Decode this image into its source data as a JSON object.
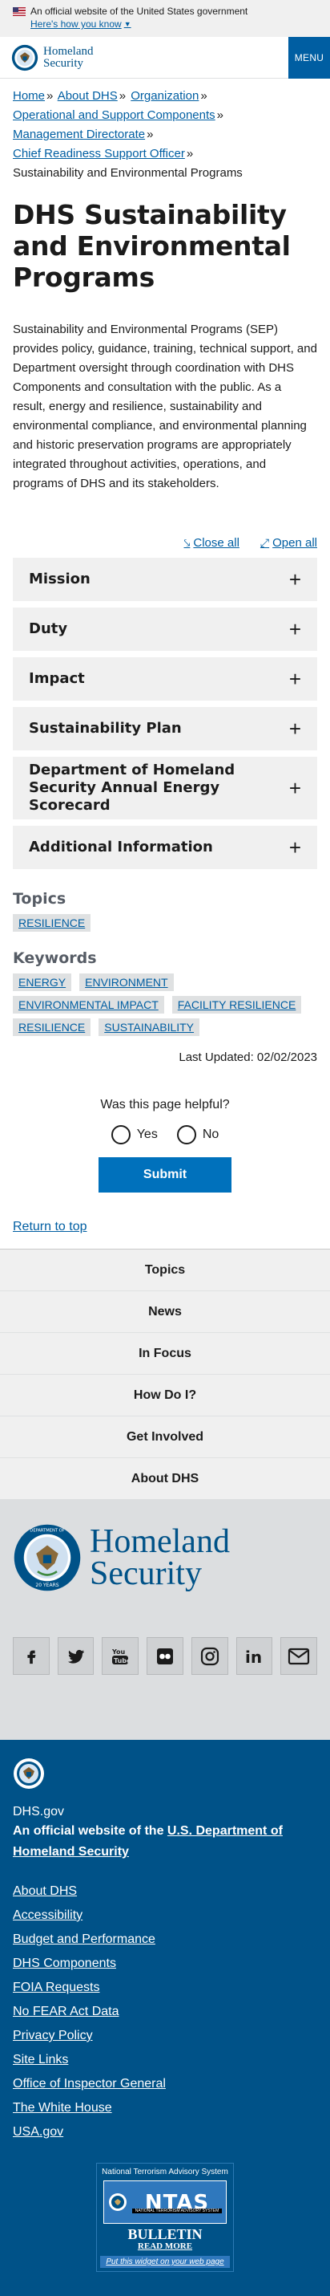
{
  "gov_banner": {
    "official_text": "An official website of the United States government",
    "how_you_know": "Here's how you know",
    "flag_icon": "us-flag-icon"
  },
  "header": {
    "logo_line1": "Homeland",
    "logo_line2": "Security",
    "menu_label": "MENU"
  },
  "breadcrumb": {
    "items": [
      "Home",
      "About DHS",
      "Organization",
      "Operational and Support Components",
      "Management Directorate",
      "Chief Readiness Support Officer"
    ],
    "current": "Sustainability and Environmental Programs",
    "separator": "»"
  },
  "page": {
    "title": "DHS Sustainability and Environmental Programs",
    "intro": "Sustainability and Environmental Programs (SEP) provides policy, guidance, training, technical support, and Department oversight through coordination with DHS Components and consultation with the public. As a result, energy and resilience, sustainability and environmental compliance, and environmental planning and historic preservation programs are appropriately integrated throughout activities, operations, and programs of DHS and its stakeholders."
  },
  "accordion": {
    "close_all": "Close all",
    "open_all": "Open all",
    "items": [
      "Mission",
      "Duty",
      "Impact",
      "Sustainability Plan",
      "Department of Homeland Security Annual Energy Scorecard",
      "Additional Information"
    ]
  },
  "topics": {
    "heading": "Topics",
    "tags": [
      "RESILIENCE"
    ]
  },
  "keywords": {
    "heading": "Keywords",
    "tags": [
      "ENERGY",
      "ENVIRONMENT",
      "ENVIRONMENTAL IMPACT",
      "FACILITY RESILIENCE",
      "RESILIENCE",
      "SUSTAINABILITY"
    ]
  },
  "last_updated": "Last Updated: 02/02/2023",
  "feedback": {
    "question": "Was this page helpful?",
    "yes": "Yes",
    "no": "No",
    "submit": "Submit"
  },
  "return_to_top": "Return to top",
  "footer_nav": [
    "Topics",
    "News",
    "In Focus",
    "How Do I?",
    "Get Involved",
    "About DHS"
  ],
  "footer_logo": {
    "line1": "Homeland",
    "line2": "Security",
    "seal_text_top": "DEPARTMENT OF",
    "seal_years": "20 YEARS"
  },
  "social": [
    "facebook-icon",
    "twitter-icon",
    "youtube-icon",
    "flickr-icon",
    "instagram-icon",
    "linkedin-icon",
    "email-icon"
  ],
  "footer_bottom": {
    "site": "DHS.gov",
    "official_prefix": "An official website of the ",
    "official_link": "U.S. Department of Homeland Security",
    "links": [
      "About DHS",
      "Accessibility",
      "Budget and Performance",
      "DHS Components",
      "FOIA Requests",
      "No FEAR Act Data",
      "Privacy Policy",
      "Site Links",
      "Office of Inspector General",
      "The White House",
      "USA.gov"
    ]
  },
  "ntas": {
    "top": "National Terrorism Advisory System",
    "word": "NTAS",
    "sub": "NATIONAL TERRORISM ADVISORY SYSTEM",
    "bulletin": "BULLETIN",
    "read_more": "READ MORE",
    "widget": "Put this widget on your web page"
  },
  "colors": {
    "primary": "#005ea2",
    "dhs_blue": "#005288",
    "accordion_bg": "#f0f0f0"
  }
}
